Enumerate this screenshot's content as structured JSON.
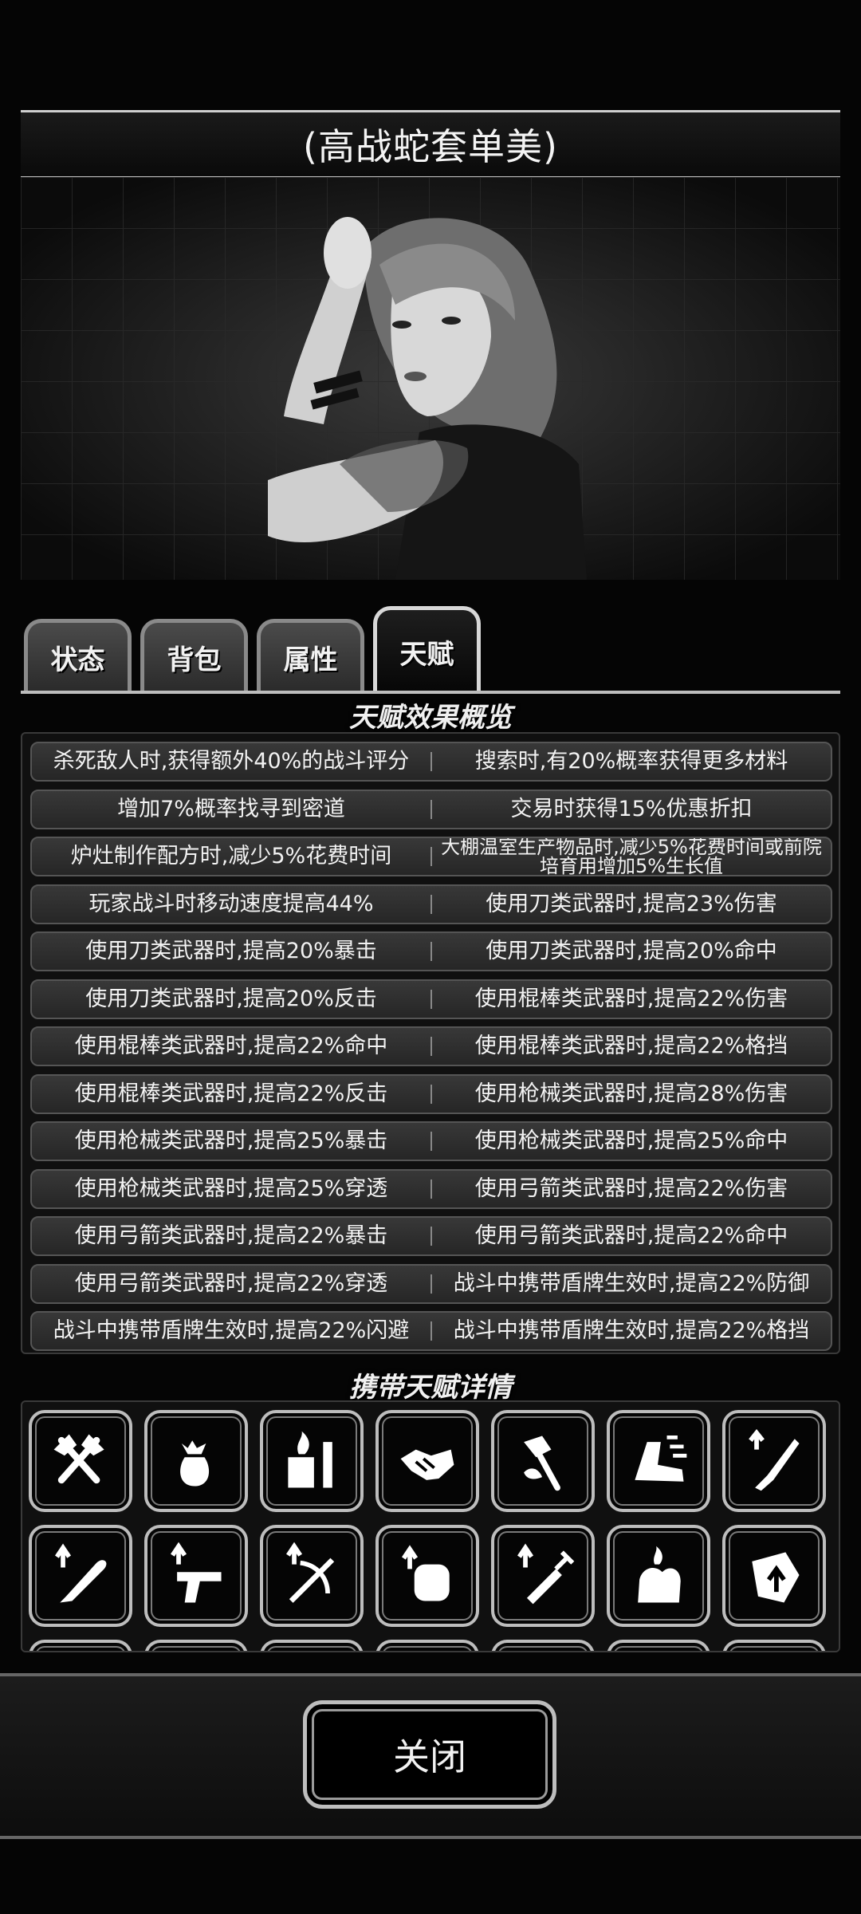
{
  "header": {
    "title": "(高战蛇套单美)"
  },
  "portrait": {
    "alt": "character-portrait"
  },
  "tabs": [
    {
      "label": "状态",
      "active": false
    },
    {
      "label": "背包",
      "active": false
    },
    {
      "label": "属性",
      "active": false
    },
    {
      "label": "天赋",
      "active": true
    }
  ],
  "effects_section": {
    "title": "天赋效果概览",
    "rows": [
      [
        "杀死敌人时,获得额外40%的战斗评分",
        "搜索时,有20%概率获得更多材料"
      ],
      [
        "增加7%概率找寻到密道",
        "交易时获得15%优惠折扣"
      ],
      [
        "炉灶制作配方时,减少5%花费时间",
        "大棚温室生产物品时,减少5%花费时间或前院培育用增加5%生长值"
      ],
      [
        "玩家战斗时移动速度提高44%",
        "使用刀类武器时,提高23%伤害"
      ],
      [
        "使用刀类武器时,提高20%暴击",
        "使用刀类武器时,提高20%命中"
      ],
      [
        "使用刀类武器时,提高20%反击",
        "使用棍棒类武器时,提高22%伤害"
      ],
      [
        "使用棍棒类武器时,提高22%命中",
        "使用棍棒类武器时,提高22%格挡"
      ],
      [
        "使用棍棒类武器时,提高22%反击",
        "使用枪械类武器时,提高28%伤害"
      ],
      [
        "使用枪械类武器时,提高25%暴击",
        "使用枪械类武器时,提高25%命中"
      ],
      [
        "使用枪械类武器时,提高25%穿透",
        "使用弓箭类武器时,提高22%伤害"
      ],
      [
        "使用弓箭类武器时,提高22%暴击",
        "使用弓箭类武器时,提高22%命中"
      ],
      [
        "使用弓箭类武器时,提高22%穿透",
        "战斗中携带盾牌生效时,提高22%防御"
      ],
      [
        "战斗中携带盾牌生效时,提高22%闪避",
        "战斗中携带盾牌生效时,提高22%格挡"
      ]
    ]
  },
  "talents_section": {
    "title": "携带天赋详情",
    "icons": [
      "crossed-axes-icon",
      "money-bag-icon",
      "stove-fire-icon",
      "handshake-icon",
      "greenhouse-tools-icon",
      "speed-boot-icon",
      "knife-up-icon",
      "bat-up-icon",
      "pistol-up-icon",
      "crossbow-up-icon",
      "fist-up-icon",
      "syringe-up-icon",
      "flexing-arm-icon",
      "shield-up-icon"
    ]
  },
  "footer": {
    "close_label": "关闭"
  }
}
